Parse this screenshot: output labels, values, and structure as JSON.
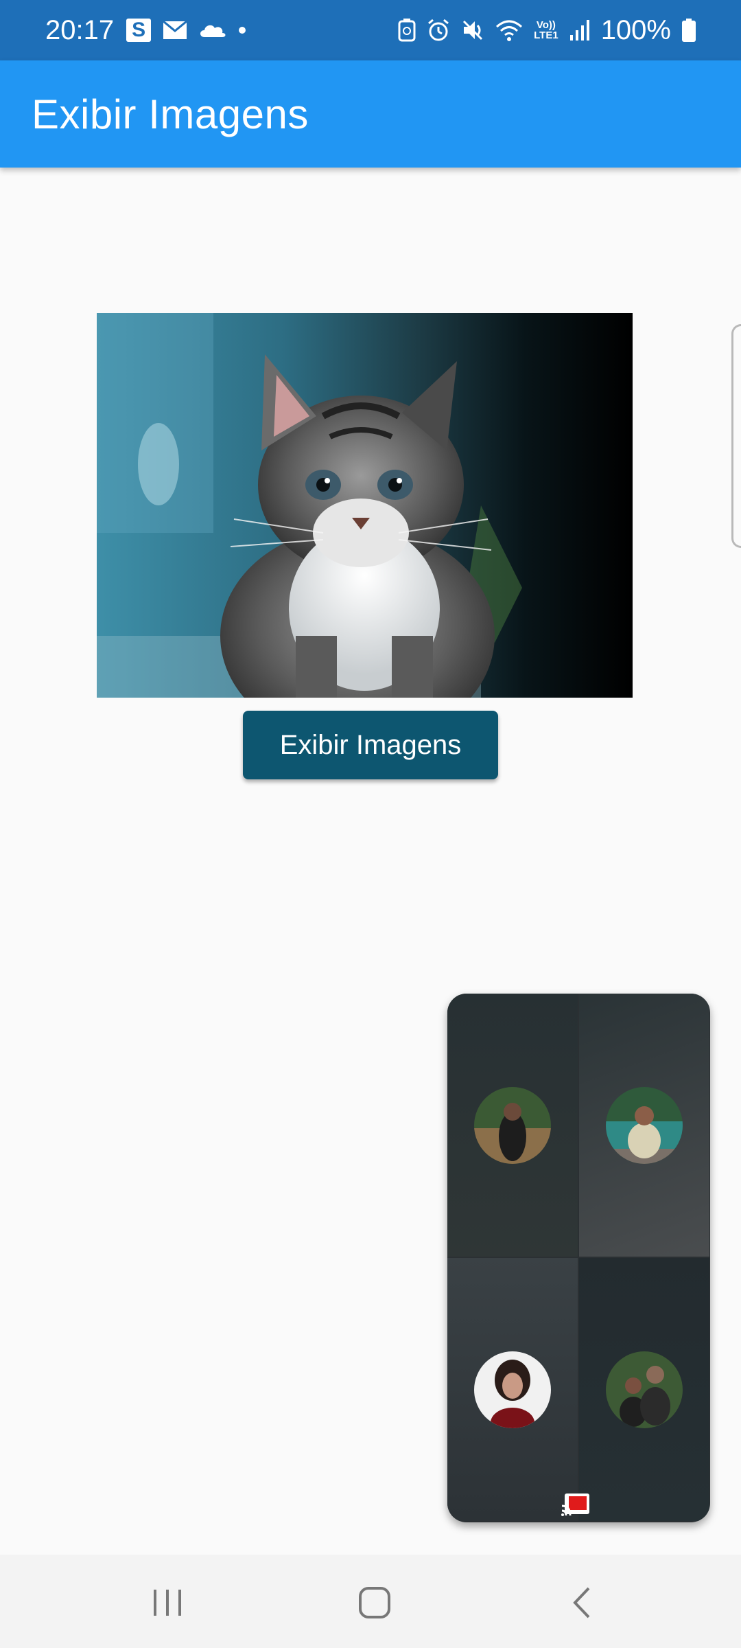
{
  "status_bar": {
    "time": "20:17",
    "battery": "100%",
    "app_icons": [
      "s-app-icon",
      "mail-icon",
      "cloud-icon",
      "dot-icon"
    ],
    "system_icons": [
      "battery-saver-icon",
      "alarm-icon",
      "mute-icon",
      "wifi-icon",
      "volte-icon",
      "signal-icon",
      "battery-icon"
    ],
    "volte_label_top": "Vo))",
    "volte_label_bottom": "LTE1"
  },
  "app_bar": {
    "title": "Exibir Imagens",
    "color": "#2196f3"
  },
  "main": {
    "image_icon": "kitten-photo",
    "button_label": "Exibir Imagens",
    "button_color": "#0d5670"
  },
  "call_panel": {
    "participants": [
      "participant-1",
      "participant-2",
      "participant-3",
      "participant-4"
    ],
    "cast_icon": "screen-cast-icon"
  },
  "nav_bar": {
    "buttons": [
      "recents-icon",
      "home-icon",
      "back-icon"
    ]
  }
}
